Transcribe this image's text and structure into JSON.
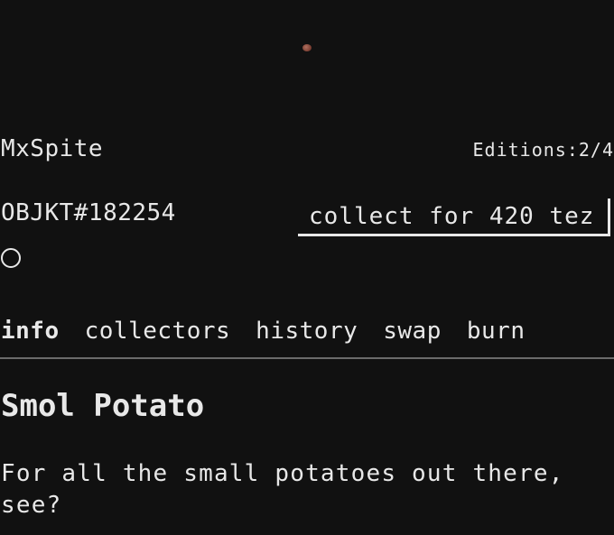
{
  "artwork": {
    "icon": "potato-artwork"
  },
  "meta": {
    "creator": "MxSpite",
    "editions": "Editions:2/4",
    "objkt_id": "OBJKT#182254",
    "collect_label": "collect for 420 tez"
  },
  "tabs": [
    {
      "label": "info",
      "active": true
    },
    {
      "label": "collectors",
      "active": false
    },
    {
      "label": "history",
      "active": false
    },
    {
      "label": "swap",
      "active": false
    },
    {
      "label": "burn",
      "active": false
    }
  ],
  "content": {
    "title": "Smol Potato",
    "description": "For all the small potatoes out there, see?"
  }
}
